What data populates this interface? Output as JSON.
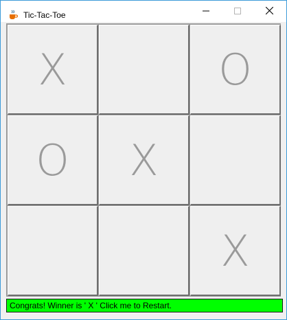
{
  "window": {
    "title": "Tic-Tac-Toe"
  },
  "title_bar_icons": {
    "app": "java-cup-icon",
    "minimize": "minimize-icon",
    "maximize": "maximize-icon",
    "close": "close-icon"
  },
  "board": {
    "cells": [
      [
        "X",
        "",
        "O"
      ],
      [
        "O",
        "X",
        ""
      ],
      [
        "",
        "",
        "X"
      ]
    ]
  },
  "status": {
    "message": "Congrats! Winner is ' X ' Click me to Restart."
  },
  "colors": {
    "status_bg": "#00ff00",
    "mark_color": "#9a9a9a",
    "cell_bg": "#efefef",
    "window_border": "#3c9ad8"
  }
}
